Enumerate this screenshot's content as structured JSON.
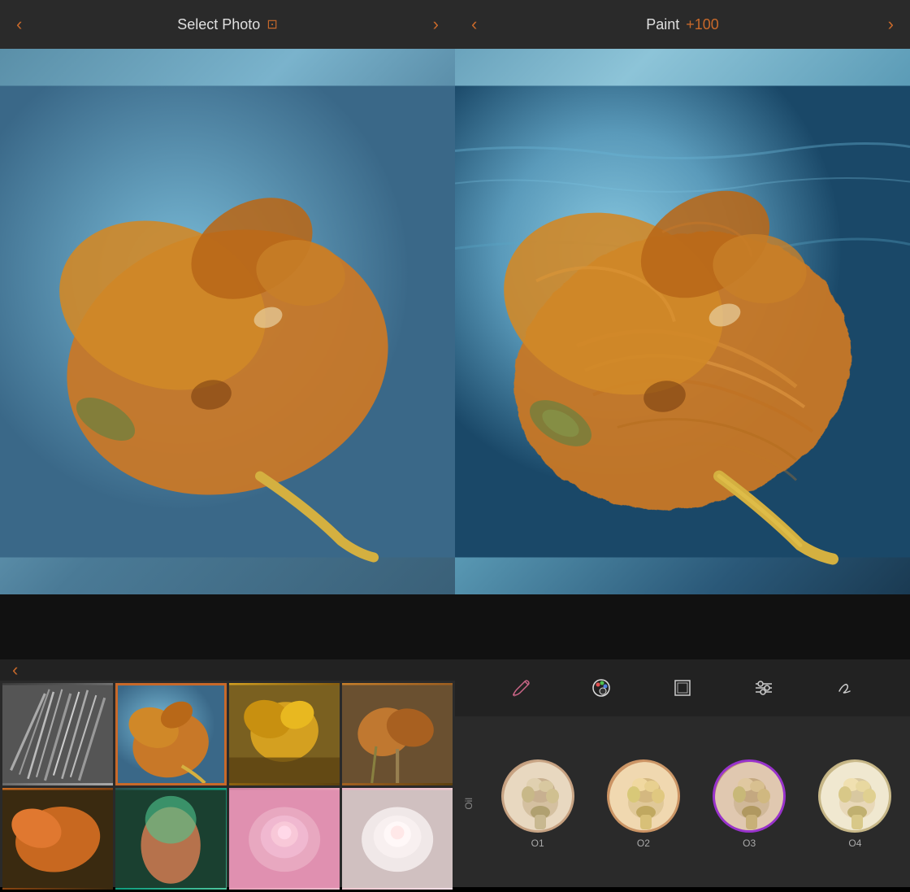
{
  "left_panel": {
    "header": {
      "back_label": "‹",
      "title": "Select Photo",
      "crop_icon": "⊡",
      "forward_label": "›"
    },
    "thumbnail_nav": {
      "back_label": "‹"
    },
    "thumbnails": [
      {
        "id": "thumb-1",
        "label": "sticks",
        "selected": false,
        "style": "thumb-1"
      },
      {
        "id": "thumb-2",
        "label": "flower-blue",
        "selected": true,
        "style": "thumb-2"
      },
      {
        "id": "thumb-3",
        "label": "yellow-flower",
        "selected": false,
        "style": "thumb-3"
      },
      {
        "id": "thumb-4",
        "label": "dry-flowers",
        "selected": false,
        "style": "thumb-4"
      },
      {
        "id": "thumb-5",
        "label": "orange-leaf",
        "selected": false,
        "style": "thumb-5"
      },
      {
        "id": "thumb-6",
        "label": "green-hand",
        "selected": false,
        "style": "thumb-6"
      },
      {
        "id": "thumb-7",
        "label": "pink-rose",
        "selected": false,
        "style": "thumb-7"
      },
      {
        "id": "thumb-8",
        "label": "white-rose",
        "selected": false,
        "style": "thumb-8"
      }
    ]
  },
  "right_panel": {
    "header": {
      "back_label": "‹",
      "title": "Paint",
      "value": "+100",
      "forward_label": "›"
    },
    "tools": [
      {
        "id": "brush",
        "icon": "brush",
        "active": false
      },
      {
        "id": "palette",
        "icon": "palette",
        "active": true
      },
      {
        "id": "canvas",
        "icon": "canvas",
        "active": false
      },
      {
        "id": "adjust",
        "icon": "adjust",
        "active": false
      },
      {
        "id": "text",
        "icon": "text",
        "active": false
      }
    ],
    "oil_label": "Oil",
    "style_presets": [
      {
        "id": "O1",
        "label": "O1",
        "selected": false,
        "style": "preset-1"
      },
      {
        "id": "O2",
        "label": "O2",
        "selected": false,
        "style": "preset-2"
      },
      {
        "id": "O3",
        "label": "O3",
        "selected": true,
        "style": "preset-3"
      },
      {
        "id": "O4",
        "label": "O4",
        "selected": false,
        "style": "preset-4"
      }
    ]
  },
  "colors": {
    "accent": "#c8692a",
    "selected_ring": "#9933cc",
    "background": "#1a1a1a",
    "header_bg": "#2a2a2a",
    "strip_bg": "#111"
  }
}
